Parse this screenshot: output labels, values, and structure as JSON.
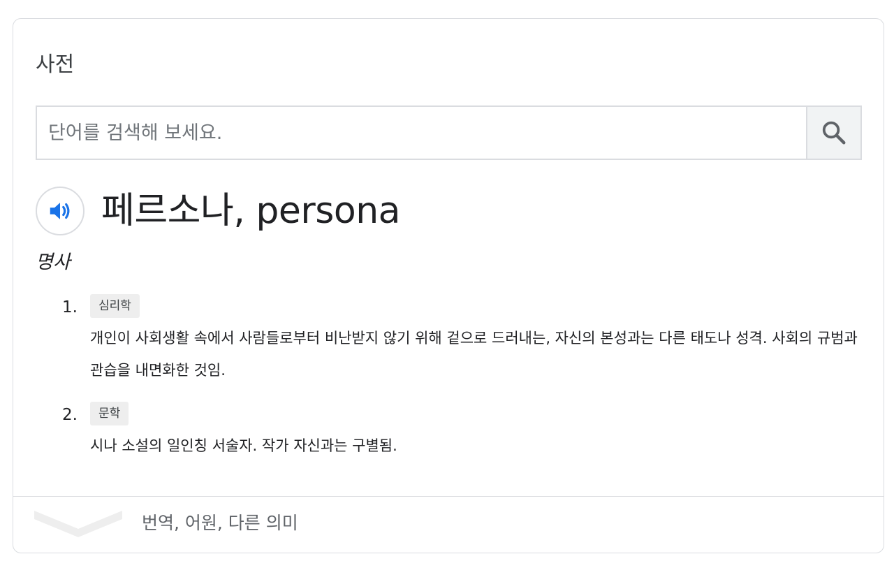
{
  "card": {
    "title": "사전"
  },
  "search": {
    "placeholder": "단어를 검색해 보세요.",
    "value": "",
    "button_icon": "search-icon"
  },
  "entry": {
    "speaker_icon": "speaker-icon",
    "headword": "페르소나, persona",
    "part_of_speech": "명사",
    "senses": [
      {
        "number": "1.",
        "domain": "심리학",
        "definition": "개인이 사회생활 속에서 사람들로부터 비난받지 않기 위해 겉으로 드러내는, 자신의 본성과는 다른 태도나 성격. 사회의 규범과 관습을 내면화한 것임."
      },
      {
        "number": "2.",
        "domain": "문학",
        "definition": "시나 소설의 일인칭 서술자. 작가 자신과는 구별됨."
      }
    ]
  },
  "expand": {
    "icon": "chevron-down-icon",
    "label": "번역, 어원, 다른 의미"
  },
  "colors": {
    "speaker_accent": "#1a73e8",
    "border": "#dadce0",
    "tag_bg": "#eeeeee"
  }
}
